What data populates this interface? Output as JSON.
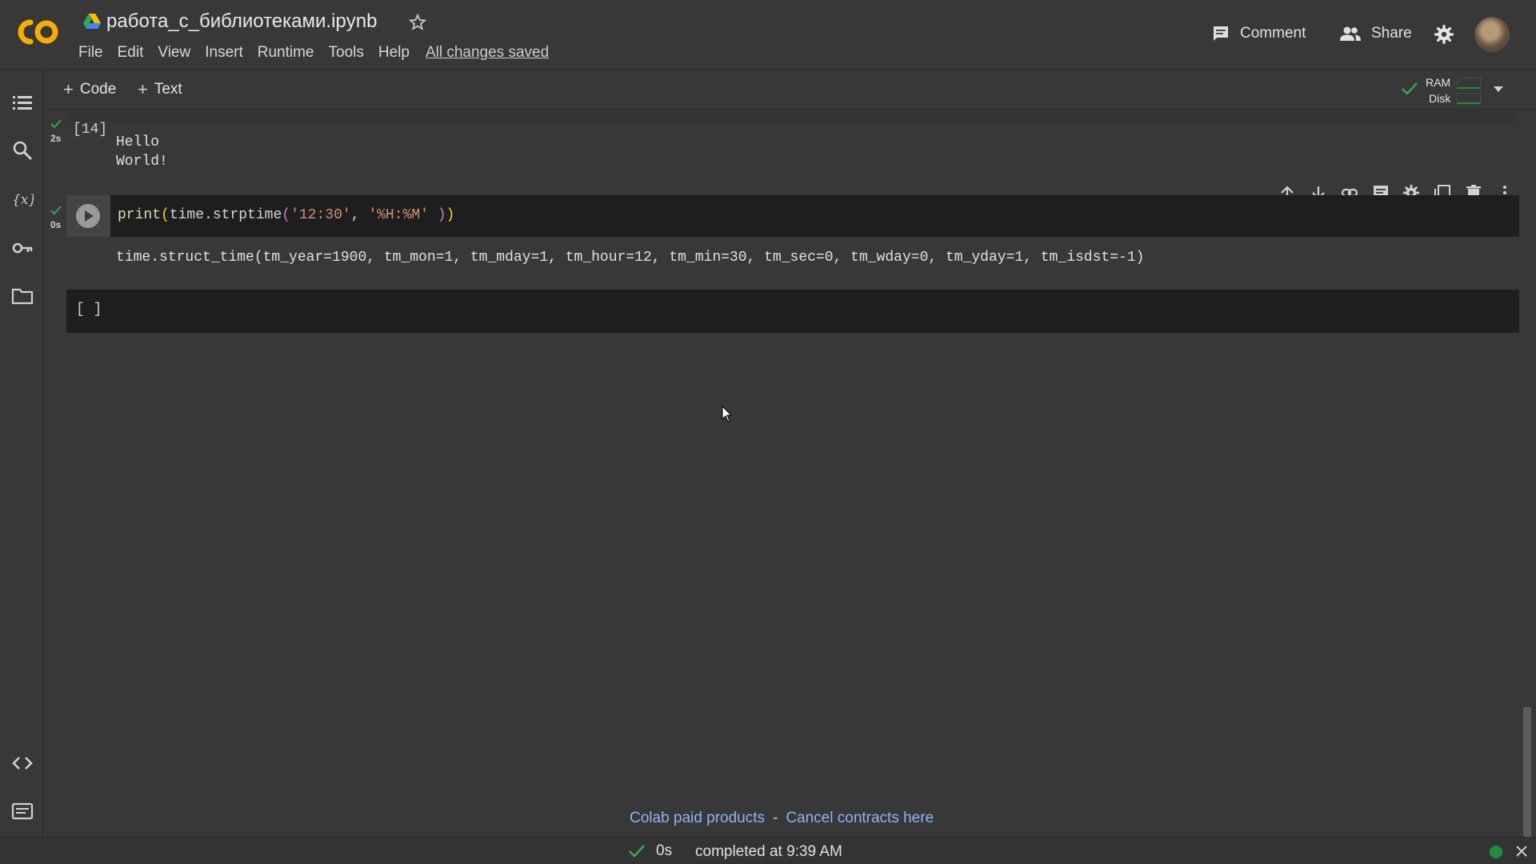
{
  "header": {
    "title": "работа_с_библиотеками.ipynb",
    "menu": [
      "File",
      "Edit",
      "View",
      "Insert",
      "Runtime",
      "Tools",
      "Help"
    ],
    "saved_status": "All changes saved",
    "comment_label": "Comment",
    "share_label": "Share"
  },
  "toolbar": {
    "code_label": "Code",
    "text_label": "Text",
    "ram_label": "RAM",
    "disk_label": "Disk"
  },
  "cells": {
    "cell1": {
      "exec_count": "[14]",
      "exec_time": "2s",
      "output_lines": [
        "Hello",
        "World!"
      ]
    },
    "cell2": {
      "exec_time": "0s",
      "code_fn": "print",
      "code_open": "(",
      "code_call": "time.strptime",
      "code_open2": "(",
      "code_arg1": "'12:30'",
      "code_sep": ", ",
      "code_arg2": "'%H:%M'",
      "code_close2": " )",
      "code_close": ")",
      "output": "time.struct_time(tm_year=1900, tm_mon=1, tm_mday=1, tm_hour=12, tm_min=30, tm_sec=0, tm_wday=0, tm_yday=1, tm_isdst=-1)"
    },
    "cell3": {
      "brackets": "[ ]"
    }
  },
  "footer": {
    "paid_products": "Colab paid products",
    "separator": "-",
    "cancel_contracts": "Cancel contracts here"
  },
  "statusbar": {
    "duration": "0s",
    "completed": "completed at 9:39 AM"
  },
  "colors": {
    "background": "#383838",
    "accent_link": "#8ab4f8",
    "success": "#1e8e3e",
    "logo": "#f9ab00"
  },
  "icons": [
    "co-logo",
    "drive-icon",
    "star-icon",
    "comment-icon",
    "share-people-icon",
    "gear-icon",
    "toc-icon",
    "search-icon",
    "variables-icon",
    "key-icon",
    "folder-icon",
    "code-snippets-icon",
    "terminal-icon",
    "check-icon",
    "chevron-down-icon",
    "chevron-up-icon",
    "arrow-up-icon",
    "arrow-down-icon",
    "link-icon",
    "comment-cell-icon",
    "cell-settings-icon",
    "mirror-cell-icon",
    "trash-icon",
    "more-vert-icon",
    "run-icon",
    "close-icon"
  ]
}
